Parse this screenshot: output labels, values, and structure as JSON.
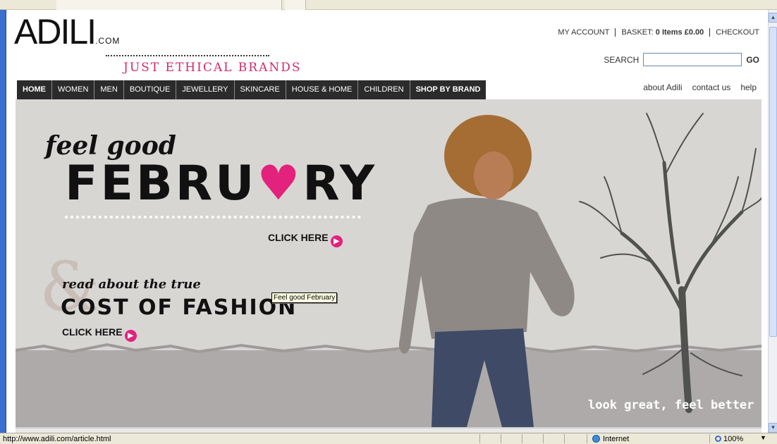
{
  "site": {
    "logo_main": "ADILI",
    "logo_suffix": ".COM",
    "tagline": "JUST ETHICAL BRANDS"
  },
  "account": {
    "my_account": "MY ACCOUNT",
    "basket_label": "BASKET:",
    "basket_value": "0 Items £0.00",
    "checkout": "CHECKOUT"
  },
  "search": {
    "label": "SEARCH",
    "value": "",
    "go": "GO"
  },
  "nav": {
    "items": [
      "HOME",
      "WOMEN",
      "MEN",
      "BOUTIQUE",
      "JEWELLERY",
      "SKINCARE",
      "HOUSE & HOME",
      "CHILDREN",
      "SHOP BY BRAND"
    ],
    "sublinks": [
      "about Adili",
      "contact us",
      "help"
    ]
  },
  "hero": {
    "feel": "feel good",
    "feb_left": "FEBRU",
    "feb_heart": "♥",
    "feb_right": "RY",
    "cta1": "CLICK HERE",
    "read": "read about the true",
    "cost": "COST OF FASHION",
    "cta2": "CLICK HERE",
    "slogan": "look great, feel better",
    "tooltip": "Feel good February"
  },
  "statusbar": {
    "url": "http://www.adili.com/article.html",
    "zone": "Internet",
    "zoom": "100%"
  },
  "colors": {
    "accent": "#e3227d",
    "nav_bg": "#2b2b2b",
    "hero_bg": "#d8d6d3"
  }
}
